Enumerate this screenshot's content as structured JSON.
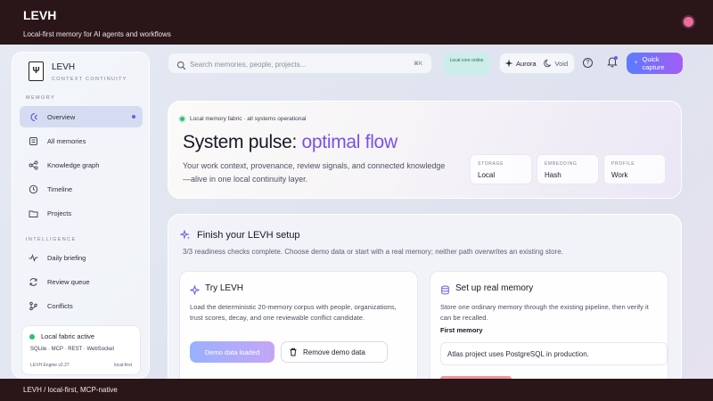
{
  "app": {
    "title": "LEVH",
    "subtitle": "Local-first memory for AI agents and workflows"
  },
  "sidebar": {
    "logo_glyph": "Ψ",
    "brand_name": "LEVH",
    "brand_sub": "CONTEXT CONTINUITY",
    "memory_section": "MEMORY",
    "intelligence_section": "INTELLIGENCE",
    "memory_items": [
      {
        "label": "Overview",
        "icon": "sparkle-icon",
        "active": true
      },
      {
        "label": "All memories",
        "icon": "list-icon"
      },
      {
        "label": "Knowledge graph",
        "icon": "graph-icon"
      },
      {
        "label": "Timeline",
        "icon": "clock-icon"
      },
      {
        "label": "Projects",
        "icon": "folder-icon"
      }
    ],
    "intelligence_items": [
      {
        "label": "Daily briefing",
        "icon": "pulse-icon"
      },
      {
        "label": "Review queue",
        "icon": "refresh-icon"
      },
      {
        "label": "Conflicts",
        "icon": "branch-icon"
      }
    ],
    "status": {
      "title": "Local fabric active",
      "stack": "SQLite · MCP · REST · WebSocket",
      "version": "LEVH Engine v2.27",
      "mode": "local-first"
    }
  },
  "toolbar": {
    "search_placeholder": "Search memories, people, projects...",
    "search_shortcut": "⌘K",
    "local_core": "Local core online",
    "theme_aurora": "Aurora",
    "theme_void": "Void",
    "help": "?",
    "quick_capture": "Quick capture"
  },
  "hero": {
    "badge": "Local memory fabric · all systems operational",
    "title_main": "System pulse: ",
    "title_accent": "optimal flow",
    "description": "Your work context, provenance, review signals, and connected knowledge—alive in one local continuity layer.",
    "stats": [
      {
        "label": "STORAGE",
        "value": "Local"
      },
      {
        "label": "EMBEDDING",
        "value": "Hash"
      },
      {
        "label": "PROFILE",
        "value": "Work"
      }
    ]
  },
  "setup": {
    "title": "Finish your LEVH setup",
    "description": "3/3 readiness checks complete. Choose demo data or start with a real memory; neither path overwrites an existing store.",
    "try_card": {
      "title": "Try LEVH",
      "description": "Load the deterministic 20-memory corpus with people, organizations, trust scores, decay, and one reviewable conflict candidate.",
      "loaded_button": "Demo data loaded",
      "remove_button": "Remove demo data"
    },
    "real_card": {
      "title": "Set up real memory",
      "description": "Store one ordinary memory through the existing pipeline, then verify it can be recalled.",
      "field_label": "First memory",
      "field_value": "Atlas project uses PostgreSQL in production."
    }
  },
  "footer": {
    "text": "LEVH  /  local-first, MCP-native"
  }
}
